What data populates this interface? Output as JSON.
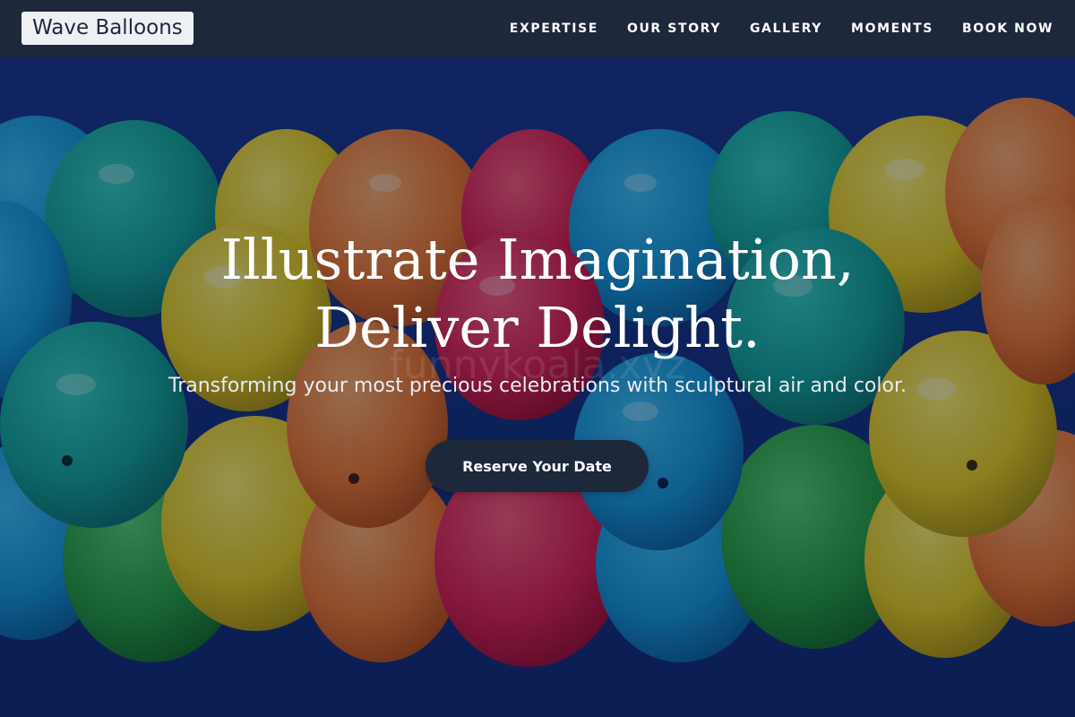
{
  "nav": {
    "brand": "Wave Balloons",
    "links": [
      {
        "label": "EXPERTISE"
      },
      {
        "label": "OUR STORY"
      },
      {
        "label": "GALLERY"
      },
      {
        "label": "MOMENTS"
      },
      {
        "label": "BOOK NOW"
      }
    ]
  },
  "hero": {
    "title_line1": "Illustrate Imagination,",
    "title_line2": "Deliver Delight.",
    "subtitle": "Transforming your most precious celebrations with sculptural air and color.",
    "cta_label": "Reserve Your Date",
    "watermark": "funnykoala.xyz"
  },
  "colors": {
    "nav_background": "#1e283b",
    "brand_background": "#eef0f4",
    "cta_background": "#1e283b",
    "sky": "#12307e"
  }
}
